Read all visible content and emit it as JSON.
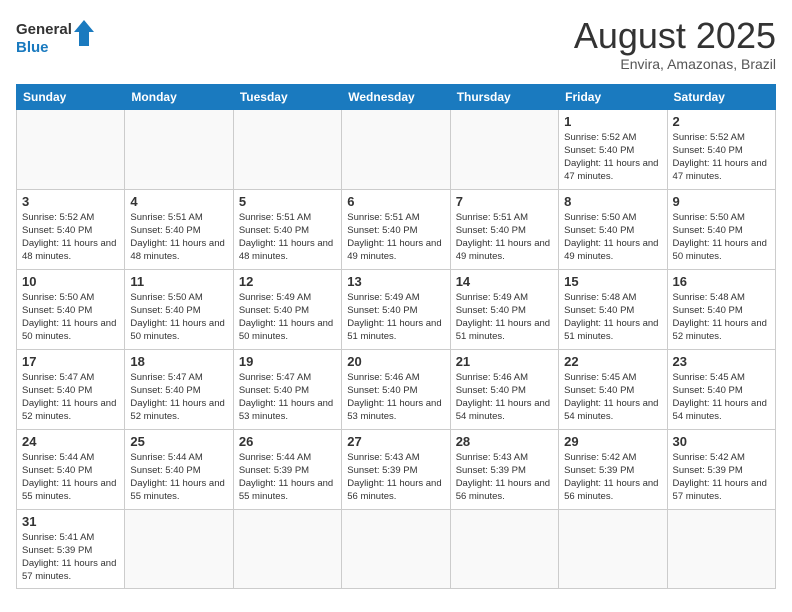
{
  "header": {
    "logo_general": "General",
    "logo_blue": "Blue",
    "title": "August 2025",
    "subtitle": "Envira, Amazonas, Brazil"
  },
  "days_of_week": [
    "Sunday",
    "Monday",
    "Tuesday",
    "Wednesday",
    "Thursday",
    "Friday",
    "Saturday"
  ],
  "weeks": [
    [
      {
        "day": "",
        "info": ""
      },
      {
        "day": "",
        "info": ""
      },
      {
        "day": "",
        "info": ""
      },
      {
        "day": "",
        "info": ""
      },
      {
        "day": "",
        "info": ""
      },
      {
        "day": "1",
        "info": "Sunrise: 5:52 AM\nSunset: 5:40 PM\nDaylight: 11 hours and 47 minutes."
      },
      {
        "day": "2",
        "info": "Sunrise: 5:52 AM\nSunset: 5:40 PM\nDaylight: 11 hours and 47 minutes."
      }
    ],
    [
      {
        "day": "3",
        "info": "Sunrise: 5:52 AM\nSunset: 5:40 PM\nDaylight: 11 hours and 48 minutes."
      },
      {
        "day": "4",
        "info": "Sunrise: 5:51 AM\nSunset: 5:40 PM\nDaylight: 11 hours and 48 minutes."
      },
      {
        "day": "5",
        "info": "Sunrise: 5:51 AM\nSunset: 5:40 PM\nDaylight: 11 hours and 48 minutes."
      },
      {
        "day": "6",
        "info": "Sunrise: 5:51 AM\nSunset: 5:40 PM\nDaylight: 11 hours and 49 minutes."
      },
      {
        "day": "7",
        "info": "Sunrise: 5:51 AM\nSunset: 5:40 PM\nDaylight: 11 hours and 49 minutes."
      },
      {
        "day": "8",
        "info": "Sunrise: 5:50 AM\nSunset: 5:40 PM\nDaylight: 11 hours and 49 minutes."
      },
      {
        "day": "9",
        "info": "Sunrise: 5:50 AM\nSunset: 5:40 PM\nDaylight: 11 hours and 50 minutes."
      }
    ],
    [
      {
        "day": "10",
        "info": "Sunrise: 5:50 AM\nSunset: 5:40 PM\nDaylight: 11 hours and 50 minutes."
      },
      {
        "day": "11",
        "info": "Sunrise: 5:50 AM\nSunset: 5:40 PM\nDaylight: 11 hours and 50 minutes."
      },
      {
        "day": "12",
        "info": "Sunrise: 5:49 AM\nSunset: 5:40 PM\nDaylight: 11 hours and 50 minutes."
      },
      {
        "day": "13",
        "info": "Sunrise: 5:49 AM\nSunset: 5:40 PM\nDaylight: 11 hours and 51 minutes."
      },
      {
        "day": "14",
        "info": "Sunrise: 5:49 AM\nSunset: 5:40 PM\nDaylight: 11 hours and 51 minutes."
      },
      {
        "day": "15",
        "info": "Sunrise: 5:48 AM\nSunset: 5:40 PM\nDaylight: 11 hours and 51 minutes."
      },
      {
        "day": "16",
        "info": "Sunrise: 5:48 AM\nSunset: 5:40 PM\nDaylight: 11 hours and 52 minutes."
      }
    ],
    [
      {
        "day": "17",
        "info": "Sunrise: 5:47 AM\nSunset: 5:40 PM\nDaylight: 11 hours and 52 minutes."
      },
      {
        "day": "18",
        "info": "Sunrise: 5:47 AM\nSunset: 5:40 PM\nDaylight: 11 hours and 52 minutes."
      },
      {
        "day": "19",
        "info": "Sunrise: 5:47 AM\nSunset: 5:40 PM\nDaylight: 11 hours and 53 minutes."
      },
      {
        "day": "20",
        "info": "Sunrise: 5:46 AM\nSunset: 5:40 PM\nDaylight: 11 hours and 53 minutes."
      },
      {
        "day": "21",
        "info": "Sunrise: 5:46 AM\nSunset: 5:40 PM\nDaylight: 11 hours and 54 minutes."
      },
      {
        "day": "22",
        "info": "Sunrise: 5:45 AM\nSunset: 5:40 PM\nDaylight: 11 hours and 54 minutes."
      },
      {
        "day": "23",
        "info": "Sunrise: 5:45 AM\nSunset: 5:40 PM\nDaylight: 11 hours and 54 minutes."
      }
    ],
    [
      {
        "day": "24",
        "info": "Sunrise: 5:44 AM\nSunset: 5:40 PM\nDaylight: 11 hours and 55 minutes."
      },
      {
        "day": "25",
        "info": "Sunrise: 5:44 AM\nSunset: 5:40 PM\nDaylight: 11 hours and 55 minutes."
      },
      {
        "day": "26",
        "info": "Sunrise: 5:44 AM\nSunset: 5:39 PM\nDaylight: 11 hours and 55 minutes."
      },
      {
        "day": "27",
        "info": "Sunrise: 5:43 AM\nSunset: 5:39 PM\nDaylight: 11 hours and 56 minutes."
      },
      {
        "day": "28",
        "info": "Sunrise: 5:43 AM\nSunset: 5:39 PM\nDaylight: 11 hours and 56 minutes."
      },
      {
        "day": "29",
        "info": "Sunrise: 5:42 AM\nSunset: 5:39 PM\nDaylight: 11 hours and 56 minutes."
      },
      {
        "day": "30",
        "info": "Sunrise: 5:42 AM\nSunset: 5:39 PM\nDaylight: 11 hours and 57 minutes."
      }
    ],
    [
      {
        "day": "31",
        "info": "Sunrise: 5:41 AM\nSunset: 5:39 PM\nDaylight: 11 hours and 57 minutes."
      },
      {
        "day": "",
        "info": ""
      },
      {
        "day": "",
        "info": ""
      },
      {
        "day": "",
        "info": ""
      },
      {
        "day": "",
        "info": ""
      },
      {
        "day": "",
        "info": ""
      },
      {
        "day": "",
        "info": ""
      }
    ]
  ]
}
